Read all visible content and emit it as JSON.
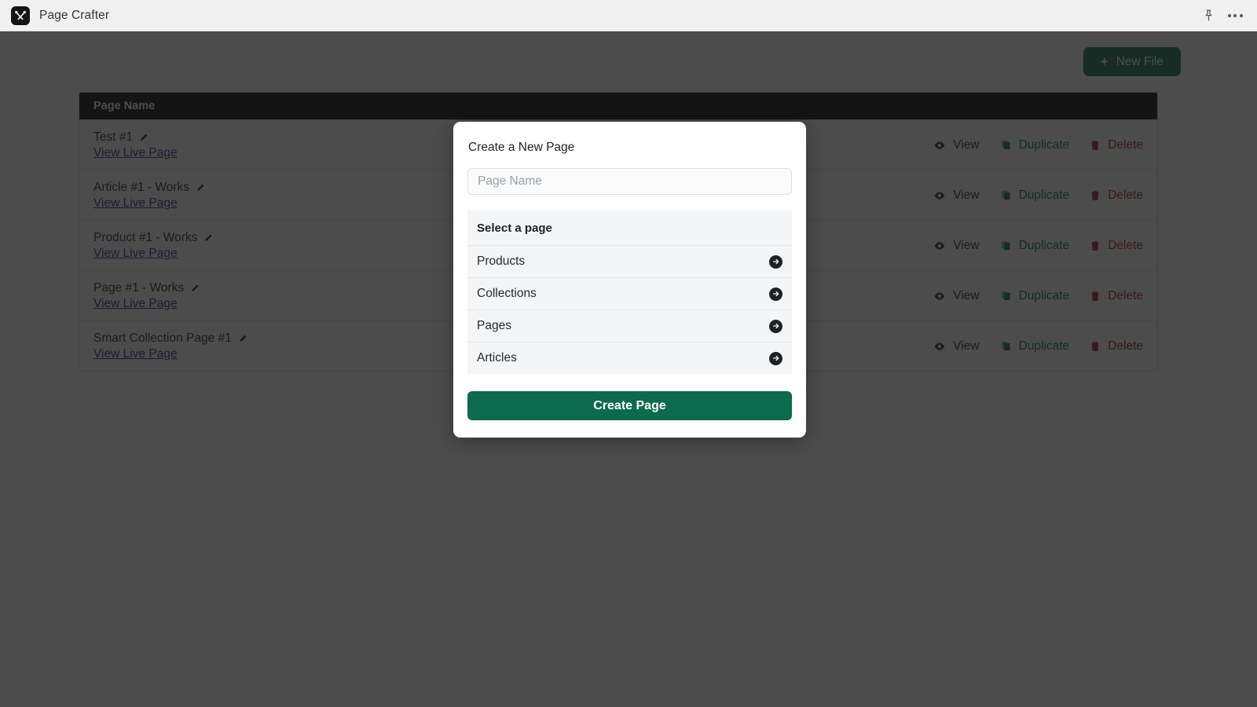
{
  "header": {
    "app_title": "Page Crafter",
    "logo_icon": "crossed-tools-icon",
    "pin_icon": "pin-icon",
    "more_icon": "more-horizontal-icon"
  },
  "toolbar": {
    "new_file_label": "New File",
    "plus_glyph": "+"
  },
  "table": {
    "column_header": "Page Name",
    "live_link_label": "View Live Page",
    "actions": {
      "view_label": "View",
      "duplicate_label": "Duplicate",
      "delete_label": "Delete"
    },
    "rows": [
      {
        "name": "Test #1"
      },
      {
        "name": "Article #1 - Works"
      },
      {
        "name": "Product #1 - Works"
      },
      {
        "name": "Page #1 - Works"
      },
      {
        "name": "Smart Collection Page #1"
      }
    ]
  },
  "modal": {
    "title": "Create a New Page",
    "input_value": "",
    "input_placeholder": "Page Name",
    "select_heading": "Select a page",
    "options": [
      {
        "label": "Products"
      },
      {
        "label": "Collections"
      },
      {
        "label": "Pages"
      },
      {
        "label": "Articles"
      }
    ],
    "submit_label": "Create Page"
  },
  "colors": {
    "brand_green": "#0b6e4f",
    "delete_red": "#a81d1d",
    "link_indigo": "#2c2a7a",
    "header_bg": "#f0f0f0",
    "table_header_bg": "#000000",
    "overlay": "rgba(26,26,26,0.78)"
  }
}
